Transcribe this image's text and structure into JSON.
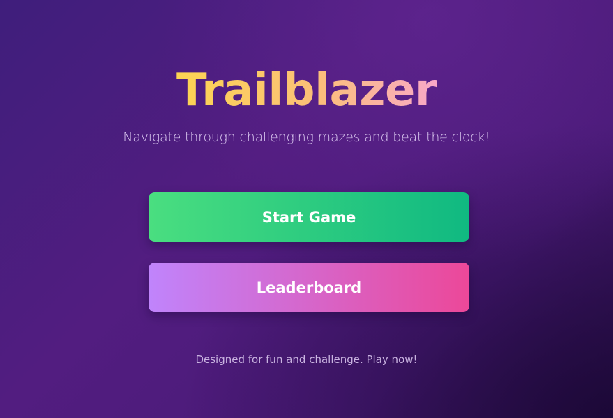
{
  "game": {
    "title": "Trailblazer",
    "subtitle": "Navigate through challenging mazes and beat the clock!",
    "footer": "Designed for fun and challenge. Play now!"
  },
  "menu": {
    "start_label": "Start Game",
    "leaderboard_label": "Leaderboard"
  },
  "colors": {
    "title_gradient": [
      "#fcd552",
      "#fbbf7a",
      "#f9a8c8"
    ],
    "start_gradient": [
      "#4ade80",
      "#10b981"
    ],
    "leaderboard_gradient": [
      "#c084fc",
      "#ec4899"
    ],
    "background": [
      "#3f1e7c",
      "#521d80",
      "#321253"
    ]
  }
}
